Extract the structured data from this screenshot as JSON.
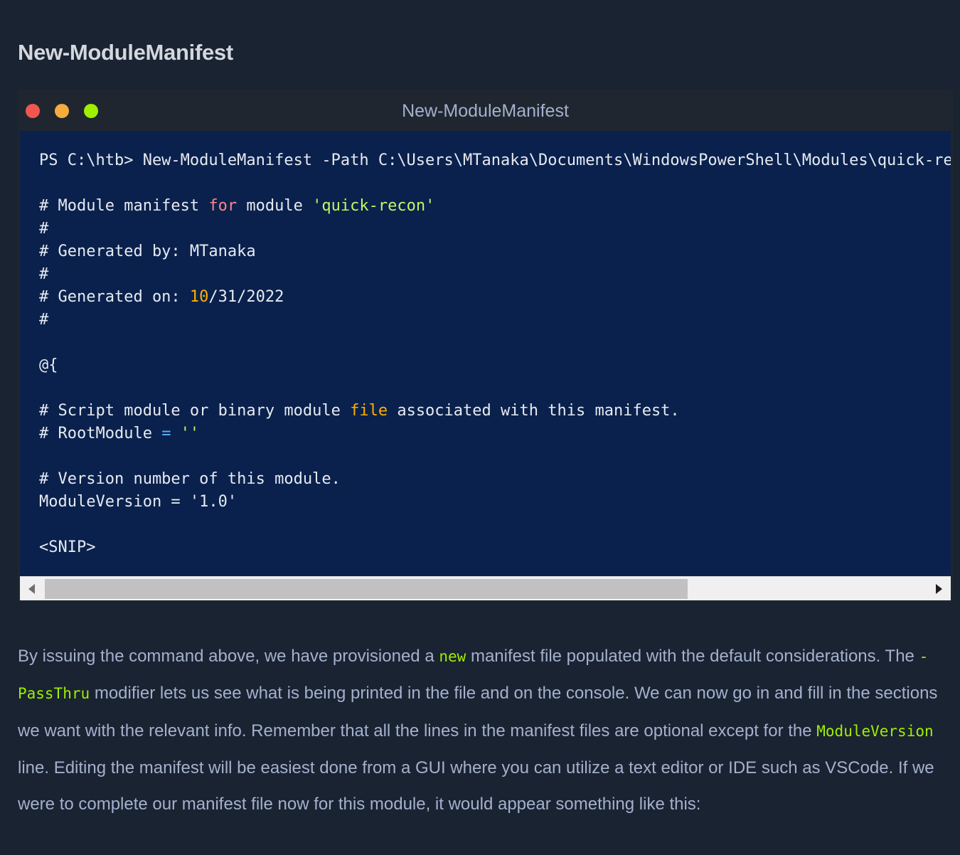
{
  "heading": "New-ModuleManifest",
  "terminal": {
    "title": "New-ModuleManifest",
    "lines": [
      "PS C:\\htb> New-ModuleManifest -Path C:\\Users\\MTanaka\\Documents\\WindowsPowerShell\\Modules\\quick-recon",
      "",
      "# Module manifest for module 'quick-recon'",
      "#",
      "# Generated by: MTanaka",
      "#",
      "# Generated on: 10/31/2022",
      "#",
      "",
      "@{",
      "",
      "# Script module or binary module file associated with this manifest.",
      "# RootModule = ''",
      "",
      "# Version number of this module.",
      "ModuleVersion = '1.0'",
      "",
      "<SNIP>"
    ],
    "highlight": {
      "line2": {
        "a": "# Module manifest ",
        "kw": "for",
        "b": " module ",
        "str": "'quick-recon'"
      },
      "line6": {
        "a": "# Generated on: ",
        "num": "10",
        "b": "/31/2022"
      },
      "line11": {
        "a": "# Script module or binary module ",
        "num": "file",
        "b": " associated with this manifest."
      },
      "line12": {
        "a": "# RootModule ",
        "op": "=",
        "b": " ",
        "str": "''"
      }
    },
    "scroll_fraction": 0.73
  },
  "paragraph": {
    "s1": "By issuing the command above, we have provisioned a ",
    "c1": "new",
    "s2": " manifest file populated with the default considerations. The ",
    "c2": "-PassThru",
    "s3": " modifier lets us see what is being printed in the file and on the console. We can now go in and fill in the sections we want with the relevant info. Remember that all the lines in the manifest files are optional except for the ",
    "c3": "ModuleVersion",
    "s4": " line. Editing the manifest will be easiest done from a GUI where you can utilize a text editor or IDE such as VSCode. If we were to complete our manifest file now for this module, it would appear something like this:"
  },
  "colors": {
    "background": "#1a2332",
    "terminal_bg": "#0a214d",
    "accent_green": "#9fef00",
    "string": "#c5f467",
    "keyword": "#ff8484",
    "number": "#ffaf00"
  }
}
